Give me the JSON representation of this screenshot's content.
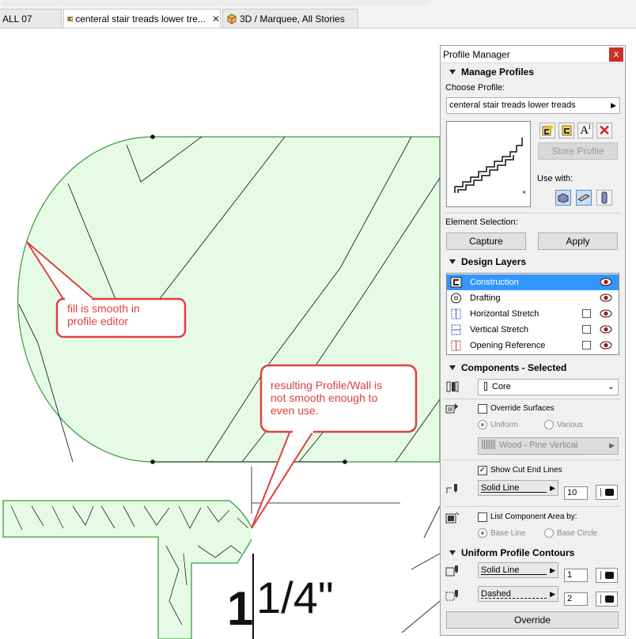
{
  "tabs": [
    {
      "label": "ALL 07",
      "active": false
    },
    {
      "label": "centeral stair treads lower tre...",
      "active": true,
      "close": "✕"
    },
    {
      "label": "3D / Marquee, All Stories",
      "active": false
    }
  ],
  "annotations": {
    "callout1": [
      "fill is smooth in",
      "profile editor"
    ],
    "callout2": [
      "resulting Profile/Wall is",
      "not smooth enough to",
      "even use."
    ]
  },
  "drawing": {
    "dimension_text": "1¹/4\""
  },
  "panel": {
    "title": "Profile Manager",
    "close": "x",
    "manage_profiles": {
      "header": "Manage Profiles",
      "choose_label": "Choose Profile:",
      "selected_profile": "centeral stair treads lower treads",
      "store_button": "Store Profile",
      "use_with_label": "Use with:",
      "element_selection_label": "Element Selection:",
      "capture_button": "Capture",
      "apply_button": "Apply"
    },
    "design_layers": {
      "header": "Design Layers",
      "items": [
        {
          "name": "Construction",
          "selected": true,
          "has_checkbox": false
        },
        {
          "name": "Drafting",
          "selected": false,
          "has_checkbox": false
        },
        {
          "name": "Horizontal Stretch",
          "selected": false,
          "has_checkbox": true
        },
        {
          "name": "Vertical Stretch",
          "selected": false,
          "has_checkbox": true
        },
        {
          "name": "Opening Reference",
          "selected": false,
          "has_checkbox": true
        }
      ]
    },
    "components": {
      "header": "Components - Selected",
      "component_value": "Core",
      "override_surfaces": "Override Surfaces",
      "uniform": "Uniform",
      "various": "Various",
      "surface_value": "Wood - Pine Vertical",
      "show_cut_end_lines": "Show Cut End Lines",
      "cut_line_type": "Solid Line",
      "cut_pen": "10",
      "list_area": "List Component Area by:",
      "base_line": "Base Line",
      "base_circle": "Base Circle"
    },
    "contours": {
      "header": "Uniform Profile Contours",
      "line1_type": "Solid Line",
      "line1_pen": "1",
      "line2_type": "Dashed",
      "line2_pen": "2",
      "override_button": "Override"
    }
  },
  "colors": {
    "fill": "#e6fbe6",
    "stroke": "#3a9a3a",
    "callout": "#e04040",
    "selection": "#3297fd"
  }
}
